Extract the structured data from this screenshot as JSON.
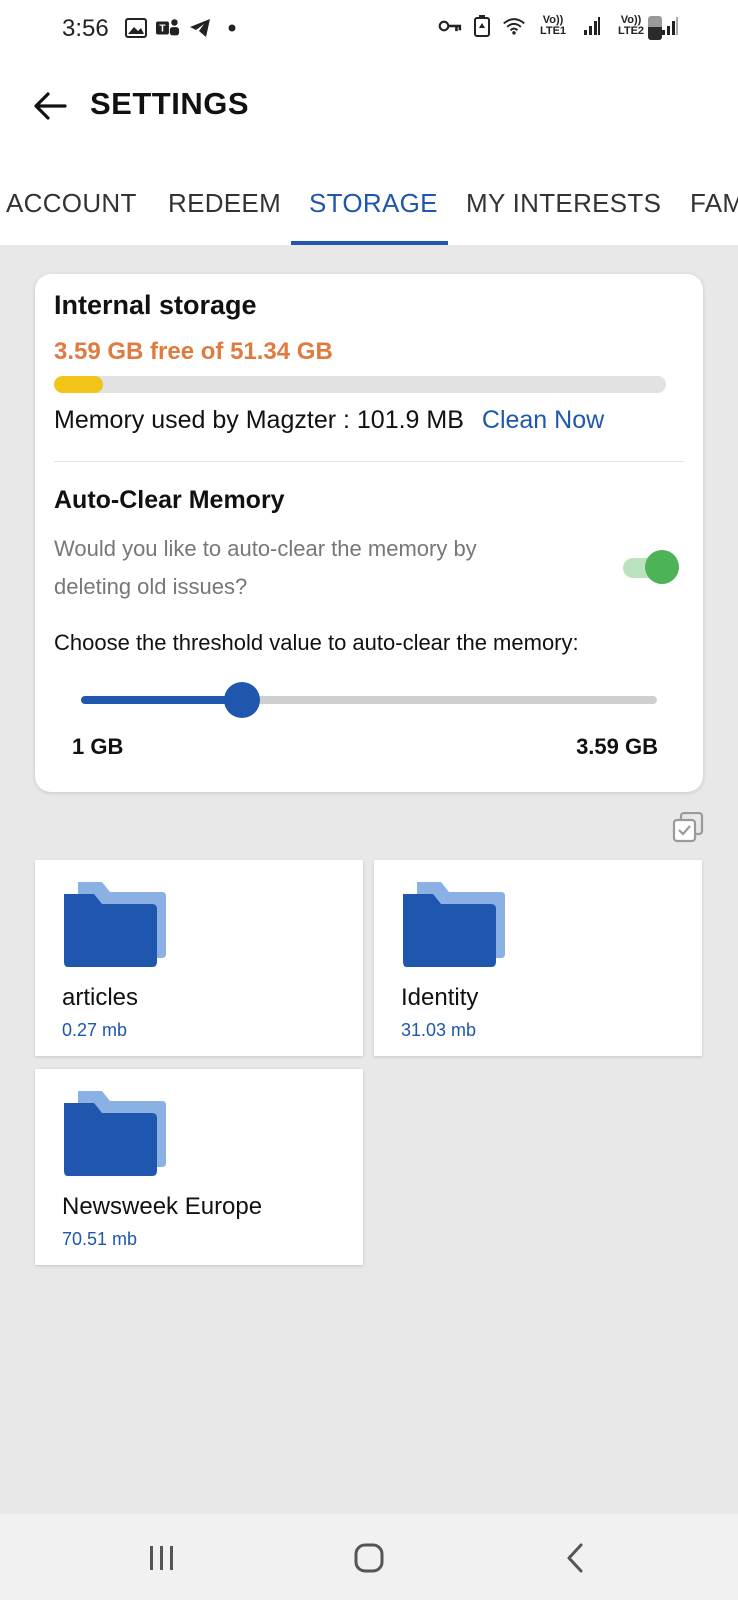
{
  "status_bar": {
    "time": "3:56",
    "sim1_label": "LTE1",
    "sim2_label": "LTE2",
    "volte1": "Vo))",
    "volte2": "Vo))",
    "battery_level": 0.55
  },
  "header": {
    "title": "SETTINGS"
  },
  "tabs": [
    {
      "label": "ACCOUNT"
    },
    {
      "label": "REDEEM"
    },
    {
      "label": "STORAGE",
      "active": true
    },
    {
      "label": "MY INTERESTS"
    },
    {
      "label": "FAM"
    }
  ],
  "storage": {
    "title": "Internal storage",
    "free_text": "3.59 GB free of 51.34 GB",
    "used_fraction": 0.08,
    "memory_label": "Memory used by Magzter : 101.9 MB",
    "clean_now": "Clean Now",
    "auto_clear_title": "Auto-Clear Memory",
    "auto_clear_desc": "Would you like to auto-clear the memory by deleting old issues?",
    "auto_clear_enabled": true,
    "threshold_text": "Choose the threshold value to auto-clear the memory:",
    "slider_min": "1 GB",
    "slider_max": "3.59 GB",
    "slider_fraction": 0.28
  },
  "folders": [
    {
      "name": "articles",
      "size": "0.27 mb"
    },
    {
      "name": "Identity",
      "size": "31.03 mb"
    },
    {
      "name": "Newsweek Europe",
      "size": "70.51 mb"
    }
  ],
  "colors": {
    "accent": "#1f57ae",
    "free_text": "#e07a3e",
    "progress": "#f2c417",
    "toggle_on": "#4cb356",
    "folder_front": "#1f57ae",
    "folder_back": "#8ab0e4"
  },
  "icons": {
    "back": "arrow-left-icon",
    "select": "select-all-icon",
    "folder": "folder-icon",
    "nav_recents": "recents-icon",
    "nav_home": "home-icon",
    "nav_back": "nav-back-icon"
  }
}
